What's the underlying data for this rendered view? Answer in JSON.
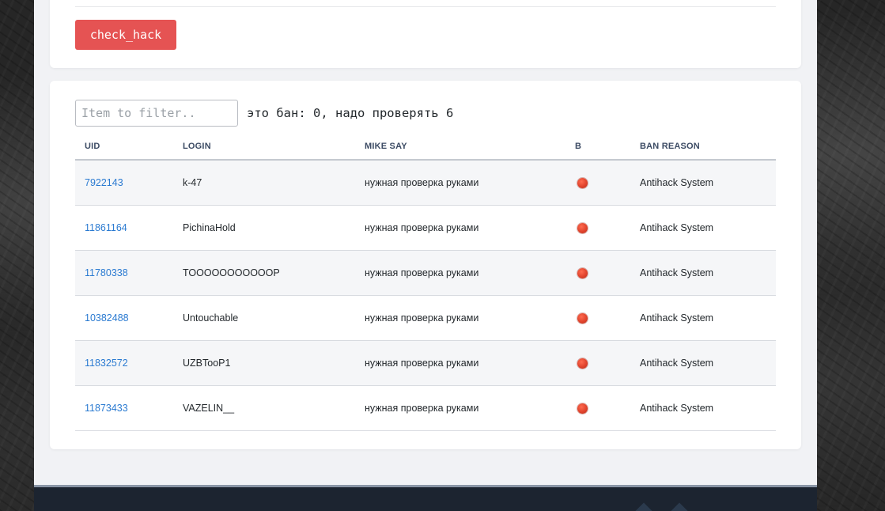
{
  "actions": {
    "check_hack_label": "check_hack"
  },
  "filter": {
    "placeholder": "Item to filter..",
    "value": "",
    "status_text": "это бан: 0, надо проверять 6"
  },
  "table": {
    "headers": {
      "uid": "UID",
      "login": "LOGIN",
      "mike_say": "MIKE SAY",
      "b": "B",
      "ban_reason": "BAN REASON"
    },
    "rows": [
      {
        "uid": "7922143",
        "login": "k-47",
        "mike_say": "нужная проверка руками",
        "b_status": "red-dot",
        "ban_reason": "Antihack System"
      },
      {
        "uid": "11861164",
        "login": "PichinaHold",
        "mike_say": "нужная проверка руками",
        "b_status": "red-dot",
        "ban_reason": "Antihack System"
      },
      {
        "uid": "11780338",
        "login": "TOOOOOOOOOOOP",
        "mike_say": "нужная проверка руками",
        "b_status": "red-dot",
        "ban_reason": "Antihack System"
      },
      {
        "uid": "10382488",
        "login": "Untouchable",
        "mike_say": "нужная проверка руками",
        "b_status": "red-dot",
        "ban_reason": "Antihack System"
      },
      {
        "uid": "11832572",
        "login": "UZBTooP1",
        "mike_say": "нужная проверка руками",
        "b_status": "red-dot",
        "ban_reason": "Antihack System"
      },
      {
        "uid": "11873433",
        "login": "VAZELIN__",
        "mike_say": "нужная проверка руками",
        "b_status": "red-dot",
        "ban_reason": "Antihack System"
      }
    ]
  },
  "colors": {
    "danger_button": "#e55353",
    "link": "#2a7ad1",
    "status_dot": "#e0432c",
    "footer": "#1c2430"
  }
}
